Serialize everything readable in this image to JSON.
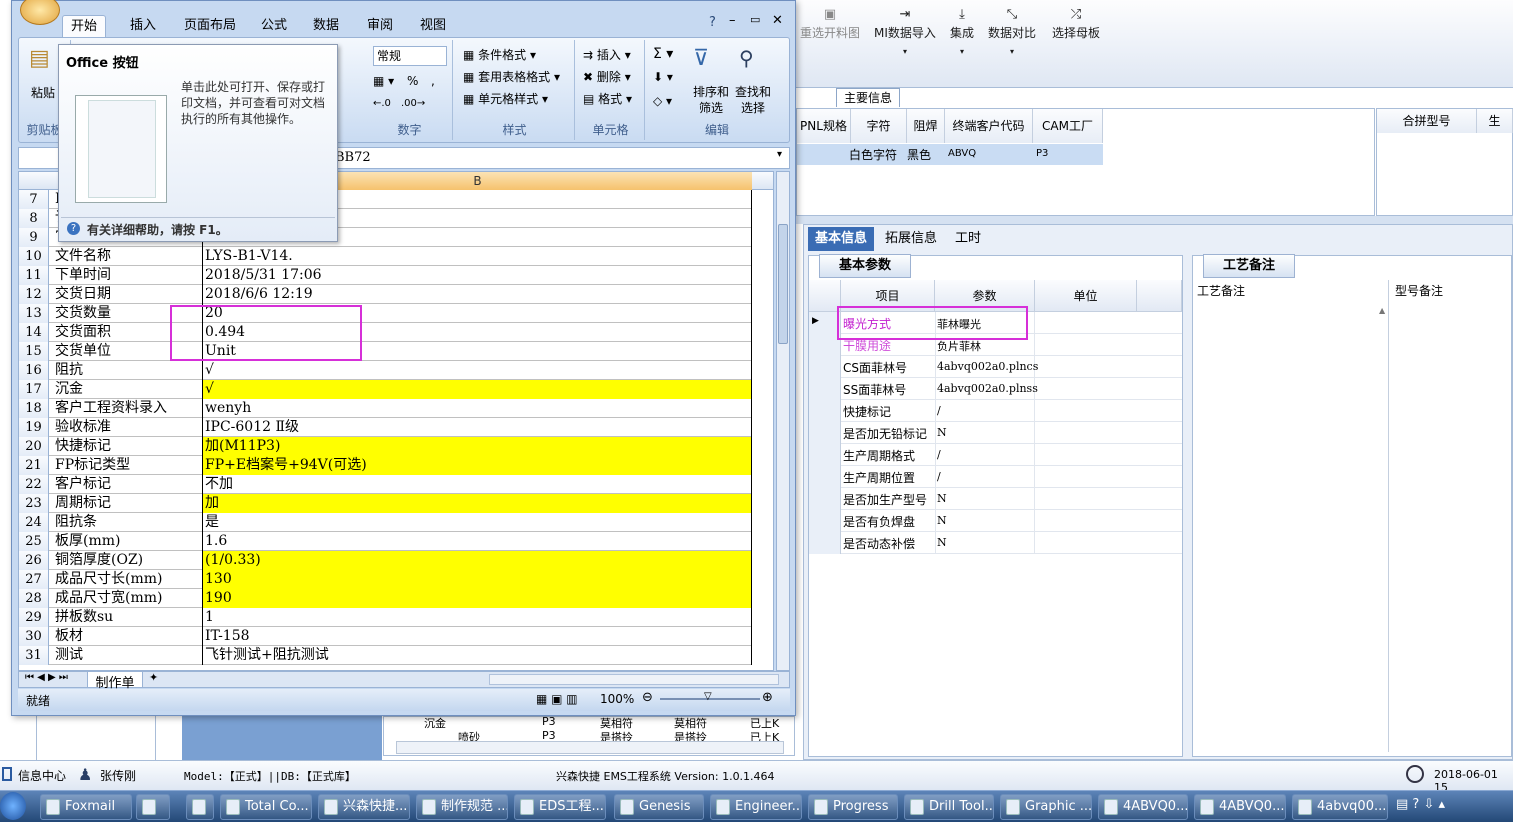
{
  "ems": {
    "toolbar": [
      {
        "label": "重选开料图",
        "icon": "image-icon"
      },
      {
        "label": "MI数据导入",
        "icon": "import-icon"
      },
      {
        "label": "集成",
        "icon": "download-icon"
      },
      {
        "label": "数据对比",
        "icon": "compare-icon"
      },
      {
        "label": "选择母板",
        "icon": "shuffle-icon"
      }
    ],
    "main_tab": "主要信息",
    "top_grid_headers": [
      "PNL规格",
      "字符",
      "阻焊",
      "终端客户代码",
      "CAM工厂"
    ],
    "top_grid_row": [
      "白色字符",
      "黑色",
      "ABVQ",
      "P3"
    ],
    "merge_headers": [
      "合拼型号",
      "生"
    ],
    "subtabs": [
      "基本信息",
      "拓展信息",
      "工时"
    ],
    "params_title": "基本参数",
    "params_headers": [
      "项目",
      "参数",
      "单位"
    ],
    "params_rows": [
      {
        "item": "曝光方式",
        "value": "菲林曝光"
      },
      {
        "item": "干膜用途",
        "value": "负片菲林"
      },
      {
        "item": "CS面菲林号",
        "value": "4abvq002a0.plncs"
      },
      {
        "item": "SS面菲林号",
        "value": "4abvq002a0.plnss"
      },
      {
        "item": "快捷标记",
        "value": "/"
      },
      {
        "item": "是否加无铅标记",
        "value": "N"
      },
      {
        "item": "生产周期格式",
        "value": "/"
      },
      {
        "item": "生产周期位置",
        "value": "/"
      },
      {
        "item": "是否加生产型号",
        "value": "N"
      },
      {
        "item": "是否有负焊盘",
        "value": "N"
      },
      {
        "item": "是否动态补偿",
        "value": "N"
      }
    ],
    "craft_title": "工艺备注",
    "craft_headers": [
      "工艺备注",
      "型号备注"
    ],
    "tree_rows": [
      {
        "name": "沉金",
        "c1": "P3",
        "c2": "莫相符",
        "c3": "莫相符",
        "c4": "已上K"
      },
      {
        "name": "喷砂",
        "c1": "P3",
        "c2": "是搭拎",
        "c3": "是搭拎",
        "c4": "已上K"
      }
    ],
    "status": {
      "info_center": "信息中心",
      "user": "张传刚",
      "model": "Model:【正式】||DB:【正式库】",
      "system": "兴森快捷 EMS工程系统 Version: 1.0.1.464",
      "datetime": "2018-06-01 15"
    }
  },
  "excel": {
    "ribbon_tabs": [
      "开始",
      "插入",
      "页面布局",
      "公式",
      "数据",
      "审阅",
      "视图"
    ],
    "paste_label": "粘贴",
    "clipboard_label": "剪贴板",
    "number_format": "常规",
    "number_group": "数字",
    "style_buttons": [
      "条件格式",
      "套用表格格式",
      "单元格样式"
    ],
    "style_group": "样式",
    "cell_buttons": [
      "插入",
      "删除",
      "格式"
    ],
    "cell_group": "单元格",
    "edit_buttons": [
      "排序和筛选",
      "查找和选择"
    ],
    "edit_group": "编辑",
    "name_box_tail": "BB72",
    "col_b": "B",
    "rows": [
      {
        "n": "7",
        "a": "F",
        "b": "",
        "hl": false
      },
      {
        "n": "8",
        "a": "讠",
        "b": "作)",
        "hl": false
      },
      {
        "n": "9",
        "a": "7",
        "b": "",
        "hl": false
      },
      {
        "n": "10",
        "a": "文件名称",
        "b": "LYS-B1-V14.",
        "hl": false
      },
      {
        "n": "11",
        "a": "下单时间",
        "b": "2018/5/31 17:06",
        "hl": false
      },
      {
        "n": "12",
        "a": "交货日期",
        "b": "2018/6/6 12:19",
        "hl": false
      },
      {
        "n": "13",
        "a": "交货数量",
        "b": "20",
        "hl": false
      },
      {
        "n": "14",
        "a": "交货面积",
        "b": "0.494",
        "hl": false
      },
      {
        "n": "15",
        "a": "交货单位",
        "b": "Unit",
        "hl": false
      },
      {
        "n": "16",
        "a": "阻抗",
        "b": "√",
        "hl": false
      },
      {
        "n": "17",
        "a": "沉金",
        "b": "√",
        "hl": true
      },
      {
        "n": "18",
        "a": "客户工程资料录入",
        "b": "wenyh",
        "hl": false
      },
      {
        "n": "19",
        "a": "验收标准",
        "b": "IPC-6012 Ⅱ级",
        "hl": false
      },
      {
        "n": "20",
        "a": "快捷标记",
        "b": "加(M11P3)",
        "hl": true
      },
      {
        "n": "21",
        "a": "FP标记类型",
        "b": "FP+E档案号+94V(可选)",
        "hl": true
      },
      {
        "n": "22",
        "a": "客户标记",
        "b": "不加",
        "hl": false
      },
      {
        "n": "23",
        "a": "周期标记",
        "b": "加",
        "hl": true
      },
      {
        "n": "24",
        "a": "阻抗条",
        "b": "是",
        "hl": false
      },
      {
        "n": "25",
        "a": "板厚(mm)",
        "b": "1.6",
        "hl": false
      },
      {
        "n": "26",
        "a": "铜箔厚度(OZ)",
        "b": "(1/0.33)",
        "hl": true
      },
      {
        "n": "27",
        "a": "成品尺寸长(mm)",
        "b": "130",
        "hl": true
      },
      {
        "n": "28",
        "a": "成品尺寸宽(mm)",
        "b": "190",
        "hl": true
      },
      {
        "n": "29",
        "a": "拼板数su",
        "b": "1",
        "hl": false
      },
      {
        "n": "30",
        "a": "板材",
        "b": "IT-158",
        "hl": false
      },
      {
        "n": "31",
        "a": "测试",
        "b": "飞针测试+阻抗测试",
        "hl": false
      }
    ],
    "sheet_tab": "制作单",
    "status_ready": "就绪",
    "zoom": "100%"
  },
  "tooltip": {
    "title": "Office 按钮",
    "body": "单击此处可打开、保存或打印文档，并可查看可对文档执行的所有其他操作。",
    "help": "有关详细帮助，请按 F1。"
  },
  "taskbar": [
    "Foxmail",
    "",
    "",
    "Total Co...",
    "兴森快捷...",
    "制作规范 ...",
    "EDS工程...",
    "Genesis",
    "Engineer...",
    "Progress",
    "Drill Tool...",
    "Graphic ...",
    "4ABVQ0...",
    "4ABVQ0...",
    "4abvq00..."
  ]
}
